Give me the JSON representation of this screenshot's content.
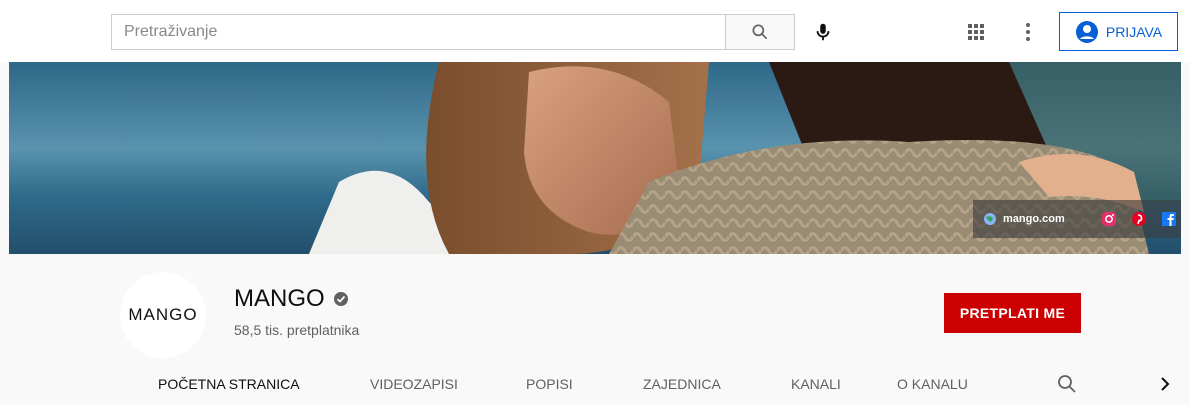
{
  "topbar": {
    "search_placeholder": "Pretraživanje",
    "signin_label": "PRIJAVA",
    "icons": [
      "search-icon",
      "mic-icon",
      "apps-icon",
      "more-vert-icon",
      "account-circle-icon"
    ]
  },
  "banner": {
    "link_text": "mango.com",
    "icons": [
      "globe-icon",
      "instagram-icon",
      "pinterest-icon",
      "facebook-icon"
    ]
  },
  "channel": {
    "avatar_text": "MANGO",
    "name": "MANGO",
    "verified": true,
    "subscribers": "58,5 tis. pretplatnika",
    "subscribe_label": "PRETPLATI ME"
  },
  "tabs": [
    {
      "label": "POČETNA STRANICA",
      "active": true
    },
    {
      "label": "VIDEOZAPISI",
      "active": false
    },
    {
      "label": "POPISI",
      "active": false
    },
    {
      "label": "ZAJEDNICA",
      "active": false
    },
    {
      "label": "KANALI",
      "active": false
    },
    {
      "label": "O KANALU",
      "active": false
    }
  ],
  "colors": {
    "accent_blue": "#065fd4",
    "subscribe_red": "#cc0000",
    "text_primary": "#0f0f0f",
    "text_secondary": "#606060"
  }
}
